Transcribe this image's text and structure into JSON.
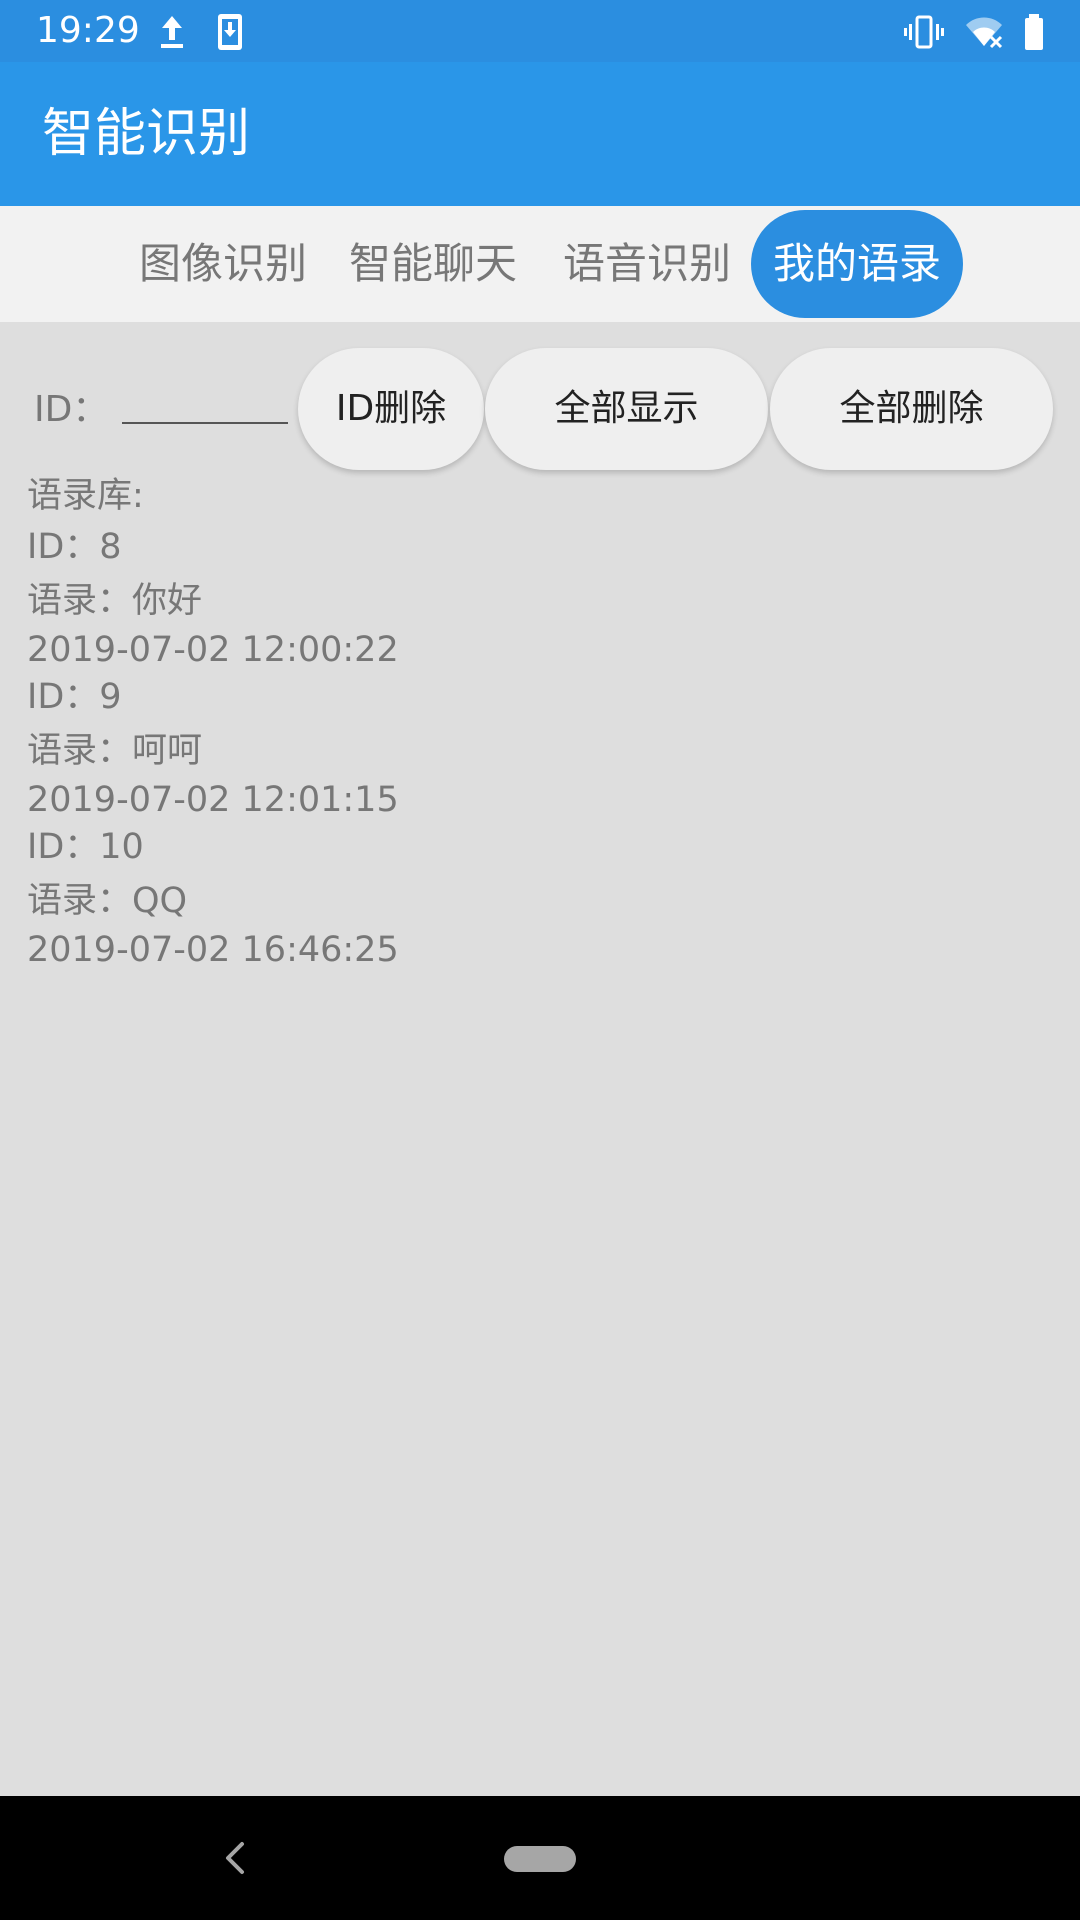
{
  "status_bar": {
    "time": "19:29",
    "left_icons": [
      "upload-icon",
      "download-to-phone-icon"
    ],
    "right_icons": [
      "vibrate-icon",
      "wifi-off-icon",
      "battery-icon"
    ]
  },
  "app_bar": {
    "title": "智能识别",
    "color": "#2a96e8"
  },
  "tabs": [
    {
      "label": "图像识别",
      "active": false
    },
    {
      "label": "智能聊天",
      "active": false
    },
    {
      "label": "语音识别",
      "active": false
    },
    {
      "label": "我的语录",
      "active": true
    }
  ],
  "controls": {
    "id_label": "ID：",
    "id_value": "",
    "delete_by_id": "ID删除",
    "show_all": "全部显示",
    "delete_all": "全部删除"
  },
  "records": {
    "title": "语录库:",
    "items": [
      {
        "id": "ID：8",
        "text": "语录：你好",
        "time": "2019-07-02 12:00:22"
      },
      {
        "id": "ID：9",
        "text": "语录：呵呵",
        "time": "2019-07-02 12:01:15"
      },
      {
        "id": "ID：10",
        "text": "语录：QQ",
        "time": "2019-07-02 16:46:25"
      }
    ]
  },
  "nav_bar": {
    "icons": [
      "back-icon",
      "home-pill-icon"
    ]
  },
  "colors": {
    "accent": "#2b8ee0",
    "background": "#dedede",
    "button": "#efefef"
  }
}
